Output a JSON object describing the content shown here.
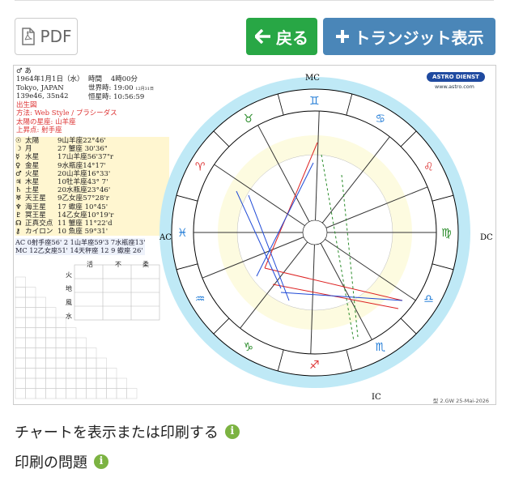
{
  "toolbar": {
    "pdf_label": "PDF",
    "back_label": "戻る",
    "transit_label": "トランジット表示"
  },
  "chart": {
    "header": {
      "name": "♂ あ",
      "date": "1964年1月1日（水）",
      "time_label": "時間",
      "time_value": "4時00分",
      "place": "Tokyo, JAPAN",
      "ut_label": "世界時:",
      "ut_value": "19:00",
      "ut_date": "12月31日",
      "coords": "139e46, 35n42",
      "st_label": "恒星時:",
      "st_value": "10:56:59"
    },
    "red_lines": [
      "出生図",
      "方法: Web Style / プラシーダス",
      "太陽の星座: 山羊座",
      "上昇点: 射手座"
    ],
    "planets": [
      {
        "glyph": "☉",
        "name": "太陽",
        "pos": "9山羊座22°46'"
      },
      {
        "glyph": "☽",
        "name": "月",
        "pos": "27 蟹座 30'36\""
      },
      {
        "glyph": "☿",
        "name": "水星",
        "pos": "17山羊座56'37\"r"
      },
      {
        "glyph": "♀",
        "name": "金星",
        "pos": "9水瓶座14°17'"
      },
      {
        "glyph": "♂",
        "name": "火星",
        "pos": "20山羊座16°33'"
      },
      {
        "glyph": "♃",
        "name": "木星",
        "pos": "10牡羊座43° 7'"
      },
      {
        "glyph": "♄",
        "name": "土星",
        "pos": "20水瓶座23°46'"
      },
      {
        "glyph": "♅",
        "name": "天王星",
        "pos": "9乙女座57°28'r"
      },
      {
        "glyph": "♆",
        "name": "海王星",
        "pos": "17 蠍座 10°45'"
      },
      {
        "glyph": "♇",
        "name": "冥王星",
        "pos": "14乙女座10°19'r"
      },
      {
        "glyph": "☊",
        "name": "正真交点",
        "pos": "11 蟹座 11°22'd"
      },
      {
        "glyph": "⚷",
        "name": "カイロン",
        "pos": "10 魚座 59°31'"
      }
    ],
    "ac_row": "AC 0射手座56' 2 1山羊座59'3 7水瓶座13'",
    "mc_row": "MC 12乙女座51' 14天秤座 12 9 蠍座 26'",
    "elements": {
      "cols": [
        "活",
        "不",
        "柔"
      ],
      "rows": [
        "火",
        "地",
        "風",
        "水"
      ]
    },
    "logo": "ASTRO DIENST",
    "logo_url": "www.astro.com",
    "mc_label": "MC",
    "ic_label": "IC",
    "ac_label": "AC",
    "dc_label": "DC",
    "footer": "型 2.GW  25-Mai-2026"
  },
  "links": {
    "print_label": "チャートを表示または印刷する",
    "problem_label": "印刷の問題"
  }
}
